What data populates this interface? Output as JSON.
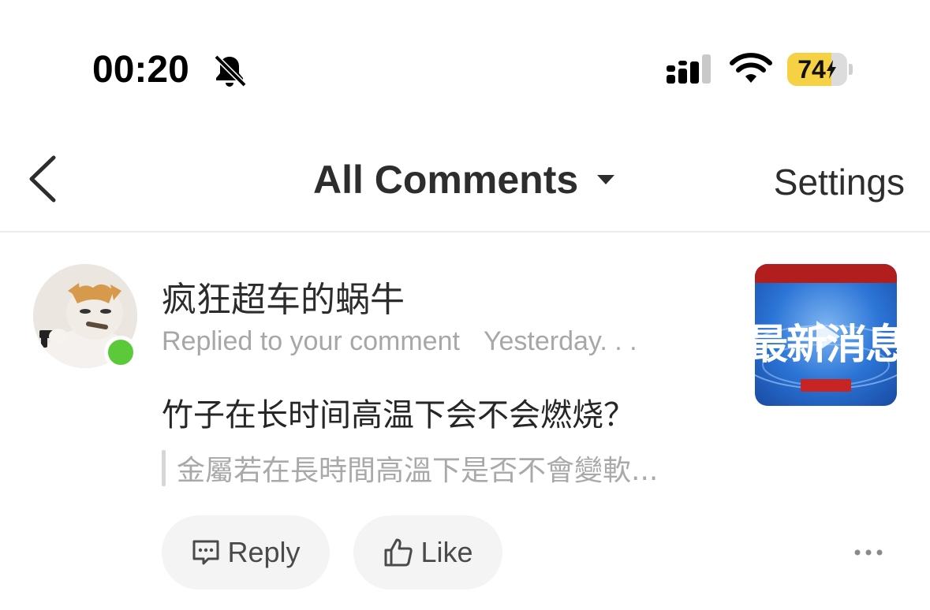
{
  "status_bar": {
    "time": "00:20",
    "battery_percent": "74",
    "battery_level": 0.74,
    "icons": [
      "bell-slash-icon",
      "cellular-signal-icon",
      "wifi-icon",
      "battery-charging-icon"
    ]
  },
  "nav": {
    "back_icon": "chevron-left-icon",
    "title": "All Comments",
    "dropdown_icon": "caret-down-icon",
    "settings_label": "Settings"
  },
  "comment": {
    "username": "疯狂超车的蜗牛",
    "action": "Replied to your comment",
    "time": "Yesterday. . .",
    "text": "竹子在长时间高温下会不会燃烧？",
    "quoted": "金屬若在長時間高溫下是否不會變軟...",
    "online": true,
    "thumbnail_text": "最新消息",
    "actions": {
      "reply_label": "Reply",
      "like_label": "Like",
      "more_icon": "more-horizontal-icon"
    }
  },
  "colors": {
    "online": "#5bc93a",
    "battery": "#f6d143",
    "thumbnail_blue": "#1f63c9",
    "thumbnail_red": "#b21e1e"
  }
}
